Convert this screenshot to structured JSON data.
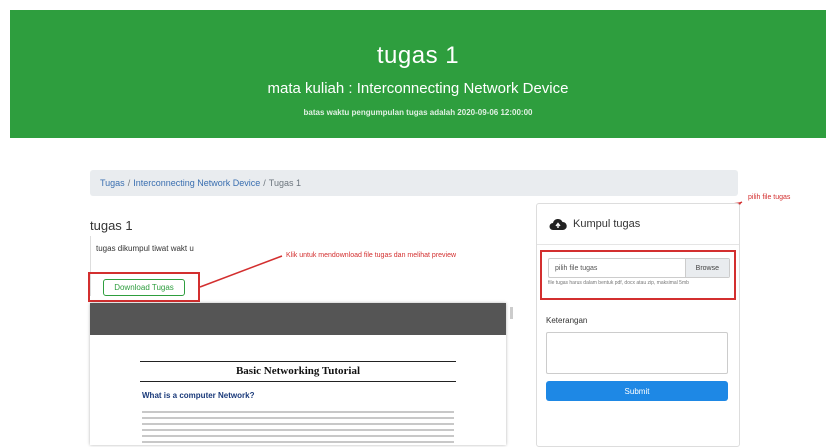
{
  "header": {
    "title": "tugas 1",
    "subtitle": "mata kuliah : Interconnecting Network Device",
    "deadline": "batas waktu pengumpulan tugas adalah 2020-09-06 12:00:00"
  },
  "breadcrumb": {
    "items": [
      "Tugas",
      "Interconnecting Network Device"
    ],
    "current": "Tugas 1"
  },
  "task": {
    "title": "tugas 1",
    "description": "tugas dikumpul tiwat wakt u",
    "download_label": "Download Tugas"
  },
  "annotations": {
    "download_note": "Klik untuk mendownload file tugas dan melihat preview",
    "upload_note": "pilih file tugas"
  },
  "document": {
    "title": "Basic Networking Tutorial",
    "heading": "What is a computer Network?"
  },
  "upload_card": {
    "title": "Kumpul tugas",
    "file_placeholder": "pilih file tugas",
    "browse_label": "Browse",
    "help_text": "file tugas harus dalam bentuk pdf, docx atau zip, maksimal 5mb",
    "keterangan_label": "Keterangan",
    "submit_label": "Submit"
  },
  "colors": {
    "header_bg": "#2e9e3e",
    "annotation_red": "#d32f2f",
    "submit_blue": "#1e88e5"
  }
}
